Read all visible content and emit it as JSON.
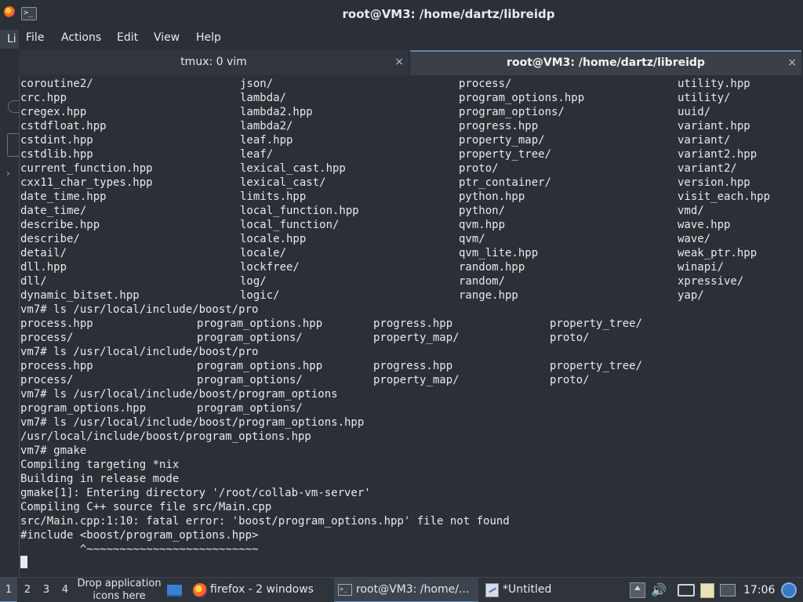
{
  "window": {
    "title": "root@VM3: /home/dartz/libreidp",
    "app_icon_glyph": ">_"
  },
  "desktop_left": {
    "label": "Li"
  },
  "menubar": [
    "File",
    "Actions",
    "Edit",
    "View",
    "Help"
  ],
  "tabs": [
    {
      "label": "tmux: 0 vim",
      "active": false,
      "close": "×"
    },
    {
      "label": "root@VM3: /home/dartz/libreidp",
      "active": true,
      "close": "×"
    }
  ],
  "terminal": {
    "grid_rows": [
      [
        "coroutine2/",
        "json/",
        "process/",
        "utility.hpp"
      ],
      [
        "crc.hpp",
        "lambda/",
        "program_options.hpp",
        "utility/"
      ],
      [
        "cregex.hpp",
        "lambda2.hpp",
        "program_options/",
        "uuid/"
      ],
      [
        "cstdfloat.hpp",
        "lambda2/",
        "progress.hpp",
        "variant.hpp"
      ],
      [
        "cstdint.hpp",
        "leaf.hpp",
        "property_map/",
        "variant/"
      ],
      [
        "cstdlib.hpp",
        "leaf/",
        "property_tree/",
        "variant2.hpp"
      ],
      [
        "current_function.hpp",
        "lexical_cast.hpp",
        "proto/",
        "variant2/"
      ],
      [
        "cxx11_char_types.hpp",
        "lexical_cast/",
        "ptr_container/",
        "version.hpp"
      ],
      [
        "date_time.hpp",
        "limits.hpp",
        "python.hpp",
        "visit_each.hpp"
      ],
      [
        "date_time/",
        "local_function.hpp",
        "python/",
        "vmd/"
      ],
      [
        "describe.hpp",
        "local_function/",
        "qvm.hpp",
        "wave.hpp"
      ],
      [
        "describe/",
        "locale.hpp",
        "qvm/",
        "wave/"
      ],
      [
        "detail/",
        "locale/",
        "qvm_lite.hpp",
        "weak_ptr.hpp"
      ],
      [
        "dll.hpp",
        "lockfree/",
        "random.hpp",
        "winapi/"
      ],
      [
        "dll/",
        "log/",
        "random/",
        "xpressive/"
      ],
      [
        "dynamic_bitset.hpp",
        "logic/",
        "range.hpp",
        "yap/"
      ]
    ],
    "lines_after": [
      [
        "vm7# ls /usr/local/include/boost/pro"
      ],
      [
        "process.hpp",
        "program_options.hpp",
        "progress.hpp",
        "property_tree/"
      ],
      [
        "process/",
        "program_options/",
        "property_map/",
        "proto/"
      ],
      [
        "vm7# ls /usr/local/include/boost/pro"
      ],
      [
        "process.hpp",
        "program_options.hpp",
        "progress.hpp",
        "property_tree/"
      ],
      [
        "process/",
        "program_options/",
        "property_map/",
        "proto/"
      ],
      [
        "vm7# ls /usr/local/include/boost/program_options"
      ],
      [
        "program_options.hpp",
        "program_options/"
      ],
      [
        "vm7# ls /usr/local/include/boost/program_options.hpp"
      ],
      [
        "/usr/local/include/boost/program_options.hpp"
      ],
      [
        "vm7# gmake"
      ],
      [
        "Compiling targeting *nix"
      ],
      [
        "Building in release mode"
      ],
      [
        "gmake[1]: Entering directory '/root/collab-vm-server'"
      ],
      [
        "Compiling C++ source file src/Main.cpp"
      ],
      [
        "src/Main.cpp:1:10: fatal error: 'boost/program_options.hpp' file not found"
      ],
      [
        "#include <boost/program_options.hpp>"
      ],
      [
        "         ^~~~~~~~~~~~~~~~~~~~~~~~~~~"
      ]
    ]
  },
  "taskbar": {
    "workspaces": [
      "1",
      "2",
      "3",
      "4"
    ],
    "drop_text": "Drop application icons here",
    "tasks": [
      {
        "label": "firefox - 2 windows",
        "icon": "firefox-icon"
      },
      {
        "label": "root@VM3: /home/...",
        "icon": "terminal-icon",
        "active": true
      },
      {
        "label": "*Untitled",
        "icon": "text-editor-icon"
      }
    ],
    "clock": "17:06",
    "tray_icons": [
      "upload-icon",
      "volume-icon",
      "network-icon",
      "clipboard-icon",
      "keyboard-icon"
    ]
  },
  "colors": {
    "background": "#2b2f36",
    "text": "#e9e9e9",
    "accent": "#5a8fcf"
  }
}
